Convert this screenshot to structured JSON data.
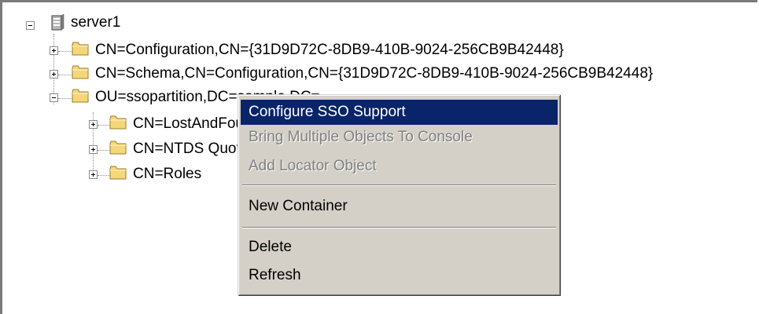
{
  "tree": {
    "root": {
      "label": "server1",
      "icon": "server-icon"
    },
    "level1": [
      {
        "label": "CN=Configuration,CN={31D9D72C-8DB9-410B-9024-256CB9B42448}",
        "expanded": false
      },
      {
        "label": "CN=Schema,CN=Configuration,CN={31D9D72C-8DB9-410B-9024-256CB9B42448}",
        "expanded": false
      },
      {
        "label": "OU=ssopartition,DC=sample,DC=",
        "expanded": true
      }
    ],
    "level2": [
      {
        "label": "CN=LostAndFound",
        "expanded": false
      },
      {
        "label": "CN=NTDS Quotas",
        "expanded": false
      },
      {
        "label": "CN=Roles",
        "expanded": false
      }
    ]
  },
  "context_menu": {
    "items": [
      {
        "label": "Configure SSO Support",
        "state": "highlighted"
      },
      {
        "label": "Bring Multiple Objects To Console",
        "state": "disabled"
      },
      {
        "label": "Add Locator Object",
        "state": "disabled"
      },
      {
        "label": "New Container",
        "state": "enabled"
      },
      {
        "label": "Delete",
        "state": "enabled"
      },
      {
        "label": "Refresh",
        "state": "enabled"
      }
    ]
  },
  "colors": {
    "highlight": "#0a246a",
    "menu_bg": "#d4d0c8",
    "disabled_text": "#808080",
    "folder": "#f5d77a"
  }
}
